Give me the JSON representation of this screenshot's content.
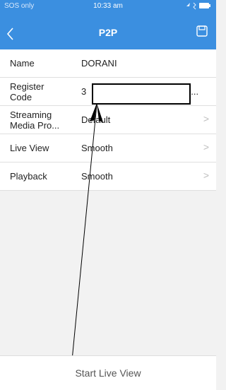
{
  "status_bar": {
    "carrier": "SOS only",
    "time": "10:33 am"
  },
  "nav": {
    "title": "P2P"
  },
  "rows": [
    {
      "label": "Name",
      "value": "DORANI"
    },
    {
      "label": "Register\nCode",
      "value": "3",
      "value_tail": "0..."
    },
    {
      "label": "Streaming\nMedia Pro...",
      "value": "Default"
    },
    {
      "label": "Live View",
      "value": "Smooth"
    },
    {
      "label": "Playback",
      "value": "Smooth"
    }
  ],
  "footer": {
    "button_label": "Start Live View"
  }
}
